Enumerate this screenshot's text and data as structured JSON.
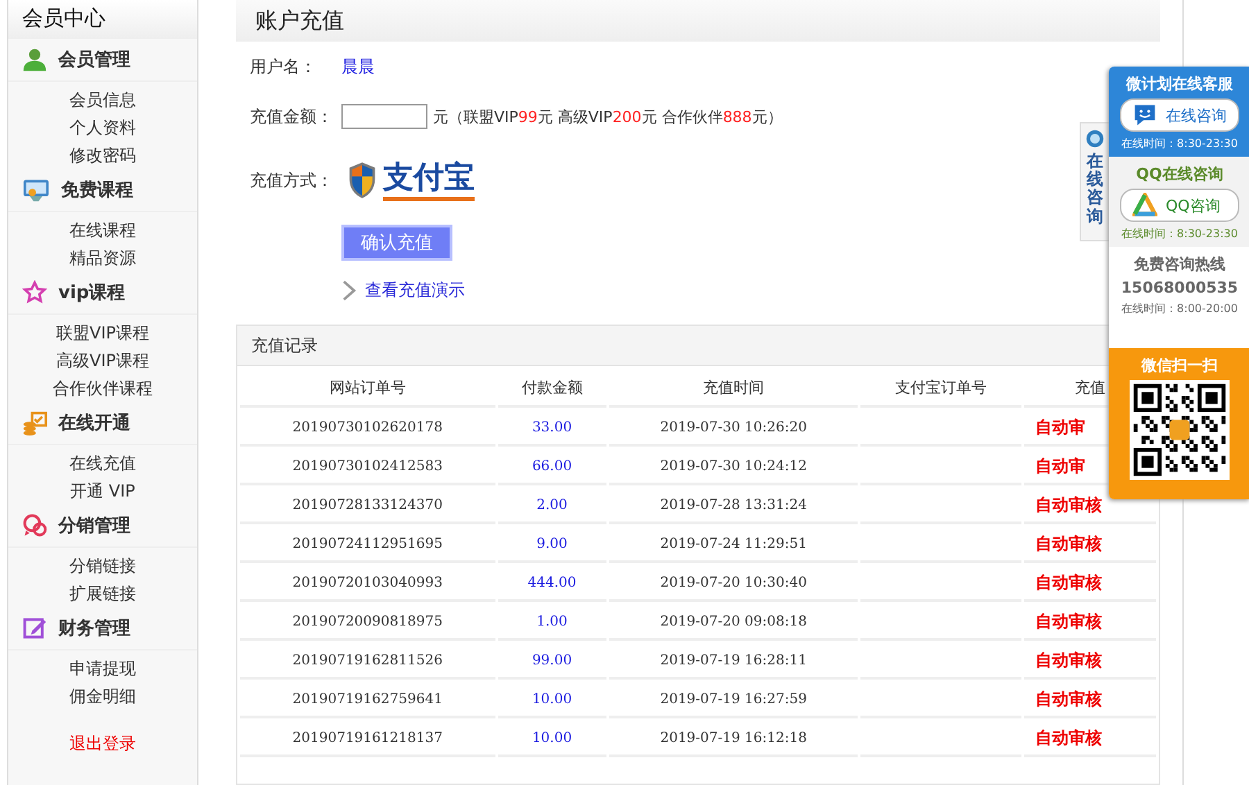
{
  "sidebar": {
    "title": "会员中心",
    "groups": [
      {
        "label": "会员管理",
        "items": [
          "会员信息",
          "个人资料",
          "修改密码"
        ]
      },
      {
        "label": "免费课程",
        "items": [
          "在线课程",
          "精品资源"
        ]
      },
      {
        "label": "vip课程",
        "items": [
          "联盟VIP课程",
          "高级VIP课程",
          "合作伙伴课程"
        ]
      },
      {
        "label": "在线开通",
        "items": [
          "在线充值",
          "开通 VIP"
        ]
      },
      {
        "label": "分销管理",
        "items": [
          "分销链接",
          "扩展链接"
        ]
      },
      {
        "label": "财务管理",
        "items": [
          "申请提现",
          "佣金明细"
        ]
      }
    ],
    "logout": "退出登录"
  },
  "page_title": "账户充值",
  "form": {
    "username_label": "用户名：",
    "username": "晨晨",
    "amount_label": "充值金额：",
    "amount_note": [
      {
        "kind": "text",
        "text": "元（联盟VIP"
      },
      {
        "kind": "price",
        "text": "99"
      },
      {
        "kind": "text",
        "text": "元 高级VIP"
      },
      {
        "kind": "price",
        "text": "200"
      },
      {
        "kind": "text",
        "text": "元 合作伙伴"
      },
      {
        "kind": "price",
        "text": "888"
      },
      {
        "kind": "text",
        "text": "元）"
      }
    ],
    "method_label": "充值方式：",
    "method_logo": "支付宝",
    "submit": "确认充值",
    "demo_link": "查看充值演示"
  },
  "records": {
    "title": "充值记录",
    "columns": [
      "网站订单号",
      "付款金额",
      "充值时间",
      "支付宝订单号",
      "充值"
    ],
    "rows": [
      [
        "20190730102620178",
        "33.00",
        "2019-07-30 10:26:20",
        "",
        "自动审"
      ],
      [
        "20190730102412583",
        "66.00",
        "2019-07-30 10:24:12",
        "",
        "自动审"
      ],
      [
        "20190728133124370",
        "2.00",
        "2019-07-28 13:31:24",
        "",
        "自动审核"
      ],
      [
        "20190724112951695",
        "9.00",
        "2019-07-24 11:29:51",
        "",
        "自动审核"
      ],
      [
        "20190720103040993",
        "444.00",
        "2019-07-20 10:30:40",
        "",
        "自动审核"
      ],
      [
        "20190720090818975",
        "1.00",
        "2019-07-20 09:08:18",
        "",
        "自动审核"
      ],
      [
        "20190719162811526",
        "99.00",
        "2019-07-19 16:28:11",
        "",
        "自动审核"
      ],
      [
        "20190719162759641",
        "10.00",
        "2019-07-19 16:27:59",
        "",
        "自动审核"
      ],
      [
        "20190719161218137",
        "10.00",
        "2019-07-19 16:12:18",
        "",
        "自动审核"
      ]
    ]
  },
  "service": {
    "tab_label": "在线咨询",
    "sections": [
      {
        "kind": "wechat",
        "title": "微计划在线客服",
        "button": "在线咨询",
        "hours": "在线时间：8:30-23:30"
      },
      {
        "kind": "qq",
        "title": "QQ在线咨询",
        "button": "QQ咨询",
        "hours": "在线时间：8:30-23:30"
      },
      {
        "kind": "hotline",
        "title": "免费咨询热线",
        "phone": "15068000535",
        "hours": "在线时间：8:00-20:00"
      },
      {
        "kind": "qr",
        "title": "微信扫一扫"
      }
    ]
  }
}
